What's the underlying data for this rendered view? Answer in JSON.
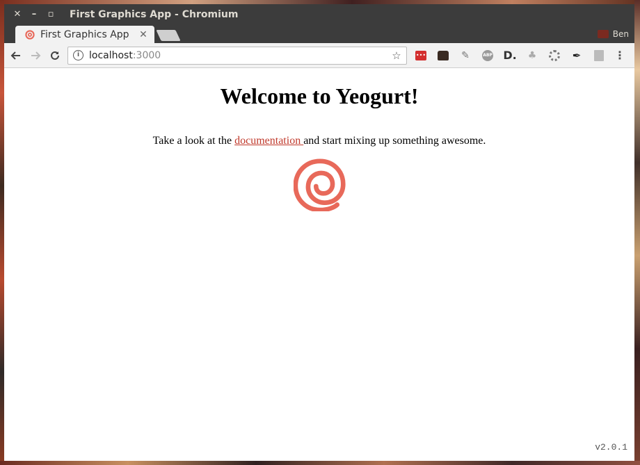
{
  "window": {
    "title": "First Graphics App - Chromium",
    "controls": {
      "close": "✕",
      "minimize": "–",
      "maximize": "▫"
    }
  },
  "tabs": [
    {
      "title": "First Graphics App",
      "close": "✕",
      "active": true
    }
  ],
  "profile": {
    "name": "Ben"
  },
  "toolbar": {
    "url_host": "localhost",
    "url_port": ":3000",
    "extensions": [
      "lastpass-icon",
      "cat-icon",
      "pin-icon",
      "adblock-plus-icon",
      "d-icon",
      "club-icon",
      "gear-icon",
      "pushpin-icon",
      "reader-icon"
    ]
  },
  "page": {
    "heading": "Welcome to Yeogurt!",
    "intro_before": "Take a look at the ",
    "link_text": "documentation ",
    "intro_after": "and start mixing up something awesome.",
    "version": "v2.0.1"
  },
  "colors": {
    "accent": "#e8695a",
    "link": "#c0392b",
    "titlebar": "#3c3c3c"
  }
}
